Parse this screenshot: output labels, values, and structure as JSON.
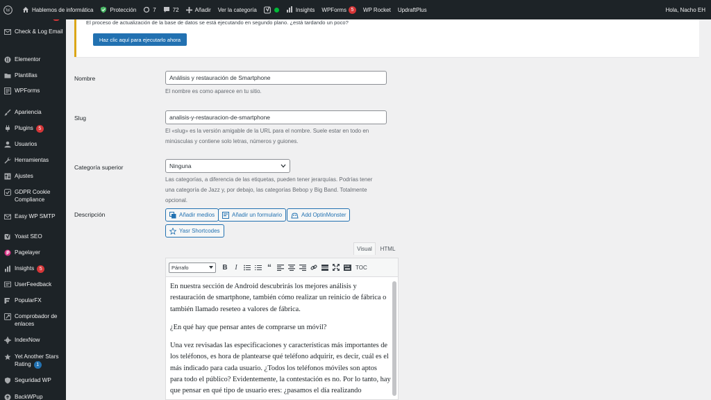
{
  "adminbar": {
    "site_name": "Hablemos de informática",
    "protection": "Protección",
    "updates_count": "7",
    "comments_count": "72",
    "add_new": "Añadir",
    "view_category": "Ver la categoría",
    "insights": "Insights",
    "wpforms": "WPForms",
    "wpforms_badge": "5",
    "wprocket": "WP Rocket",
    "updraftplus": "UpdraftPlus",
    "greeting": "Hola, Nacho EH"
  },
  "sidebar": {
    "items": [
      {
        "label": "Check & Log Email",
        "icon": "mail-icon"
      },
      {
        "label": "Elementor",
        "icon": "elementor-icon"
      },
      {
        "label": "Plantillas",
        "icon": "folder-icon"
      },
      {
        "label": "WPForms",
        "icon": "forms-icon"
      },
      {
        "label": "Apariencia",
        "icon": "brush-icon"
      },
      {
        "label": "Plugins",
        "icon": "plug-icon",
        "badge": "5"
      },
      {
        "label": "Usuarios",
        "icon": "user-icon"
      },
      {
        "label": "Herramientas",
        "icon": "wrench-icon"
      },
      {
        "label": "Ajustes",
        "icon": "settings-icon"
      },
      {
        "label": "GDPR Cookie Compliance",
        "icon": "check-icon"
      },
      {
        "label": "Easy WP SMTP",
        "icon": "envelope-icon"
      },
      {
        "label": "Yoast SEO",
        "icon": "yoast-icon"
      },
      {
        "label": "Pagelayer",
        "icon": "pagelayer-icon"
      },
      {
        "label": "Insights",
        "icon": "chart-icon",
        "badge": "5"
      },
      {
        "label": "UserFeedback",
        "icon": "feedback-icon"
      },
      {
        "label": "PopularFX",
        "icon": "popularfx-icon"
      },
      {
        "label": "Comprobador de enlaces",
        "icon": "link-icon"
      },
      {
        "label": "IndexNow",
        "icon": "gear-icon"
      },
      {
        "label": "Yet Another Stars Rating",
        "icon": "star-icon",
        "badge": "1"
      },
      {
        "label": "Seguridad WP",
        "icon": "shield-icon"
      },
      {
        "label": "BackWPup",
        "icon": "backup-icon"
      }
    ]
  },
  "notice": {
    "text": "El proceso de actualización de la base de datos se está ejecutando en segundo plano. ¿está tardando un poco?",
    "button": "Haz clic aquí para ejecutarlo ahora"
  },
  "form": {
    "name_label": "Nombre",
    "name_value": "Análisis y restauración de Smartphone",
    "name_help": "El nombre es como aparece en tu sitio.",
    "slug_label": "Slug",
    "slug_value": "analisis-y-restauracion-de-smartphone",
    "slug_help": "El «slug» es la versión amigable de la URL para el nombre. Suele estar en todo en minúsculas y contiene solo letras, números y guiones.",
    "parent_label": "Categoría superior",
    "parent_value": "Ninguna",
    "parent_help": "Las categorías, a diferencia de las etiquetas, pueden tener jerarquías. Podrías tener una categoría de Jazz y, por debajo, las categorías Bebop y Big Band. Totalmente opcional.",
    "desc_label": "Descripción"
  },
  "editor": {
    "btn_media": "Añadir medios",
    "btn_form": "Añadir un formulario",
    "btn_optin": "Add OptinMonster",
    "btn_shortcodes": "Yasr Shortcodes",
    "tab_visual": "Visual",
    "tab_html": "HTML",
    "format_select": "Párrafo",
    "toc": "TOC",
    "paragraphs": [
      "En nuestra sección de Android descubrirás los mejores análisis y restauración de smartphone, también cómo realizar un reinicio de fábrica o también llamado reseteo a valores de fábrica.",
      "¿En qué hay que pensar antes de comprarse un móvil?",
      "Una vez revisadas las especificaciones y características más importantes de los teléfonos, es hora de plantearse qué teléfono adquirir, es decir, cuál es el más indicado para cada usuario. ¿Todos los teléfonos móviles son aptos para todo el público? Evidentemente, la contestación es no. Por lo tanto, hay que pensar en qué tipo de usuario eres: ¿pasamos el día realizando"
    ]
  }
}
